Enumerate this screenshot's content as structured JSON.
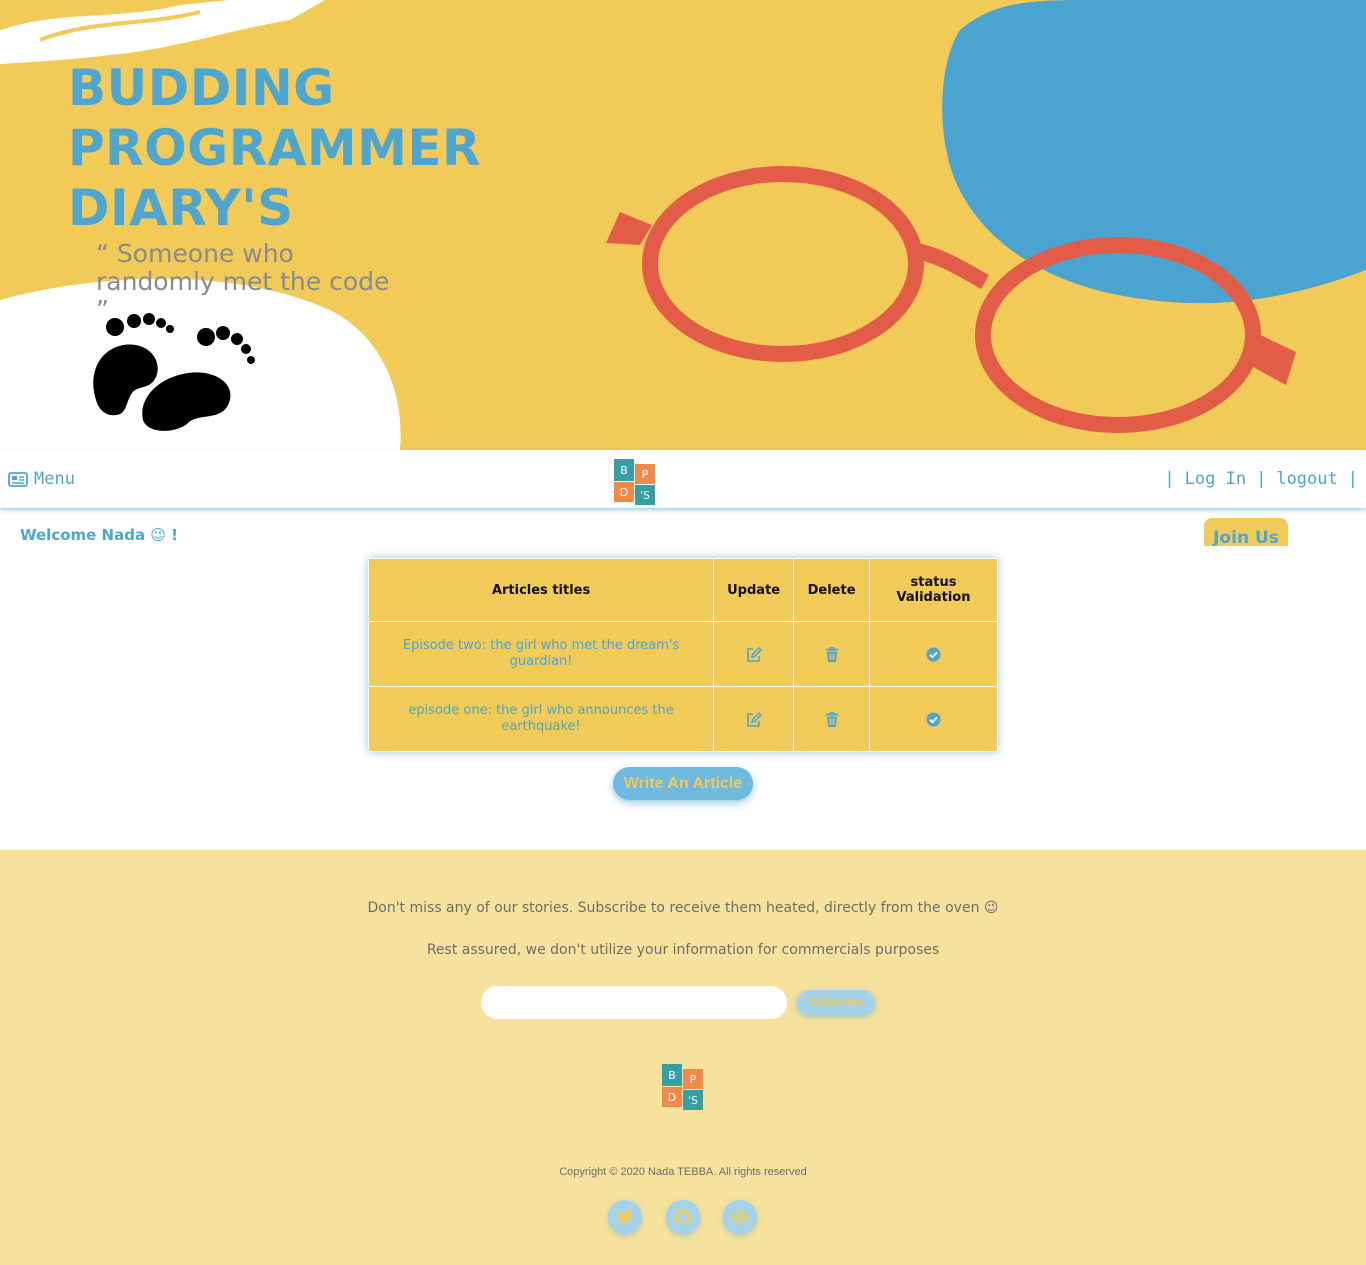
{
  "hero": {
    "title_lines": [
      "BUDDING",
      "PROGRAMMER",
      "DIARY'S"
    ],
    "tagline": "“ Someone who randomly met the code ”"
  },
  "navbar": {
    "menu_label": "Menu",
    "login_label": "Log In",
    "logout_label": "logout",
    "separator": "|",
    "logo_letters": [
      "B",
      "P",
      "D",
      "'S"
    ]
  },
  "main": {
    "welcome": "Welcome Nada 😉 !",
    "join_label": "Join Us",
    "table": {
      "headers": [
        "Articles titles",
        "Update",
        "Delete",
        "status Validation"
      ],
      "rows": [
        {
          "title": "Episode two: the girl who met the dream's guardian!"
        },
        {
          "title": "episode one: the girl who announces the earthquake!"
        }
      ]
    },
    "write_button": "Write An Article"
  },
  "footer": {
    "line1": "Don't miss any of our stories. Subscribe to receive them heated, directly from the oven 😉",
    "line2": "Rest assured, we don't utilize your information for commercials purposes",
    "subscribe_input_value": "",
    "subscribe_button": "Subscribe",
    "copyright": "Copyright © 2020 Nada TEBBA. All rights reserved",
    "social_icons": [
      "twitter-icon",
      "github-icon",
      "codepen-icon"
    ]
  },
  "colors": {
    "yellow": "#f1ca57",
    "blue": "#4ea6cf",
    "glasses_red": "#e05e4a",
    "footer_bg": "#f6e19d",
    "logo_teal": "#34a0a4",
    "logo_orange": "#f08a4b"
  }
}
